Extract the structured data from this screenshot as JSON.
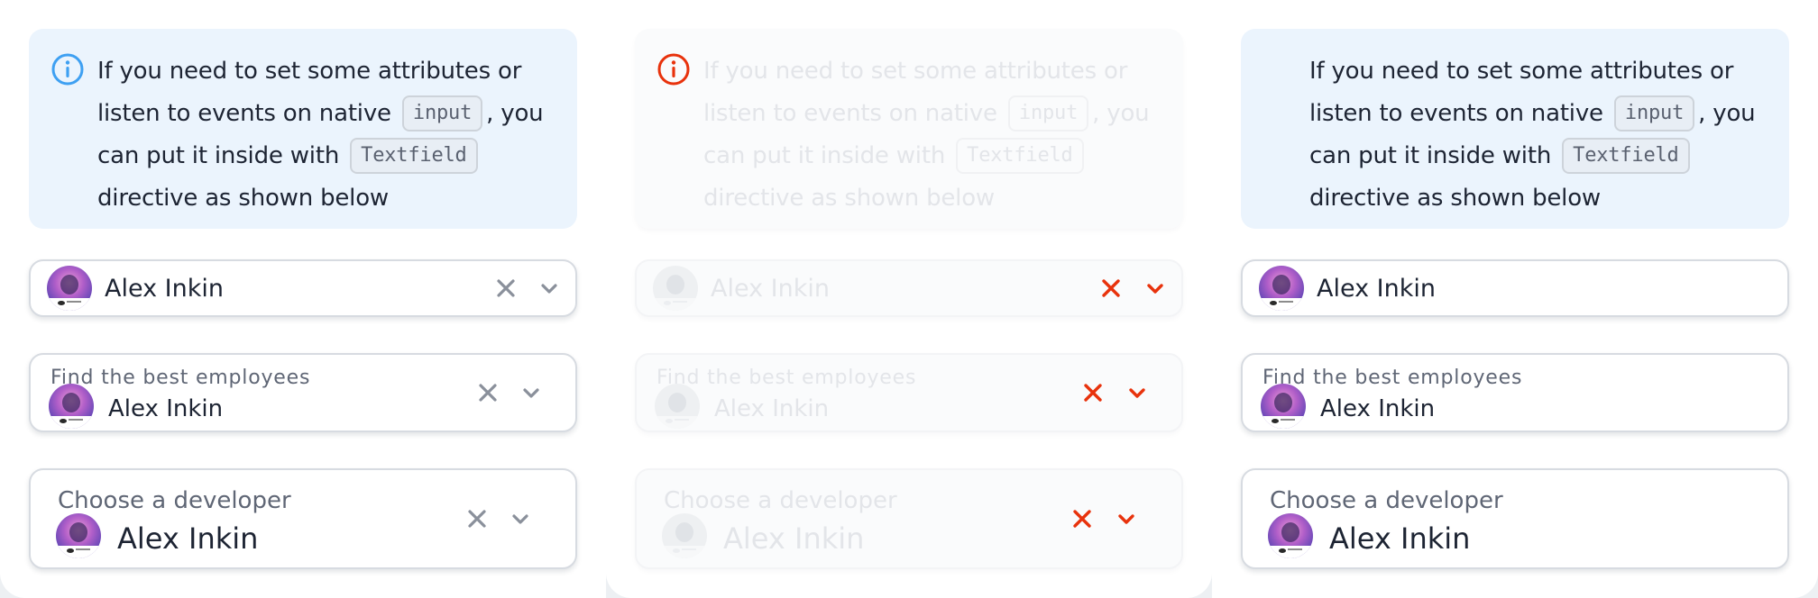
{
  "notice": {
    "line1": "If you need to set some attributes or",
    "line2_before": "listen to events on native",
    "chip_input": "input",
    "line2_after": ", you",
    "line3_before": "can put it inside with",
    "chip_textfield": "Textfield",
    "line4": "directive as shown below"
  },
  "colors": {
    "notice_background": "#ebf4fd",
    "info_icon_blue": "#3ea0f2",
    "error_red": "#e8320c",
    "icon_gray": "#8a909b",
    "text": "#1d2433"
  },
  "icons": {
    "info": "info-circle",
    "clear": "close-x",
    "expand": "chevron-down"
  },
  "columns": [
    {
      "state": "default",
      "fields": [
        {
          "value": "Alex Inkin"
        },
        {
          "label": "Find the best employees",
          "value": "Alex Inkin"
        },
        {
          "label": "Choose a developer",
          "value": "Alex Inkin"
        }
      ]
    },
    {
      "state": "disabled-invalid",
      "fields": [
        {
          "value": "Alex Inkin"
        },
        {
          "label": "Find the best employees",
          "value": "Alex Inkin"
        },
        {
          "label": "Choose a developer",
          "value": "Alex Inkin"
        }
      ]
    },
    {
      "state": "readonly",
      "fields": [
        {
          "value": "Alex Inkin"
        },
        {
          "label": "Find the best employees",
          "value": "Alex Inkin"
        },
        {
          "label": "Choose a developer",
          "value": "Alex Inkin"
        }
      ]
    }
  ]
}
